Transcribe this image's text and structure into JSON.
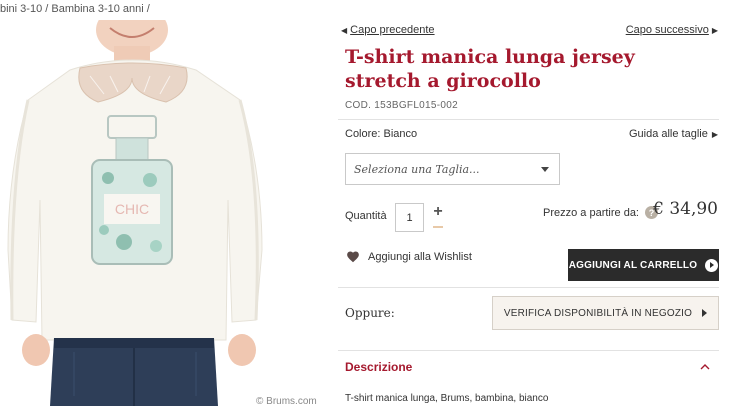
{
  "breadcrumb": {
    "text": "bini 3-10 / Bambina 3-10 anni /"
  },
  "image": {
    "print_text": "CHIC",
    "copyright": "© Brums.com"
  },
  "nav": {
    "prev_label": "Capo precedente",
    "next_label": "Capo successivo"
  },
  "product": {
    "title": "T-shirt manica lunga jersey stretch a girocollo",
    "code": "COD. 153BGFL015-002",
    "color": "Colore: Bianco",
    "size_guide": "Guida alle taglie",
    "size_placeholder": "Seleziona una Taglia...",
    "quantity_label": "Quantità",
    "quantity_value": "1",
    "price_label": "Prezzo a partire da:",
    "price": "€ 34,90"
  },
  "actions": {
    "wishlist": "Aggiungi alla Wishlist",
    "add_to_cart": "AGGIUNGI AL CARRELLO",
    "or_label": "Oppure:",
    "check_store": "VERIFICA DISPONIBILITÀ IN NEGOZIO"
  },
  "description": {
    "title": "Descrizione",
    "text": "T-shirt manica lunga, Brums, bambina, bianco"
  },
  "colors": {
    "accent": "#a5192e",
    "dark_button": "#2b2b2b",
    "store_button_bg": "#f7f3ee"
  },
  "icons": {
    "help": "question-mark",
    "heart": "heart-icon",
    "play": "play-circle-icon"
  }
}
